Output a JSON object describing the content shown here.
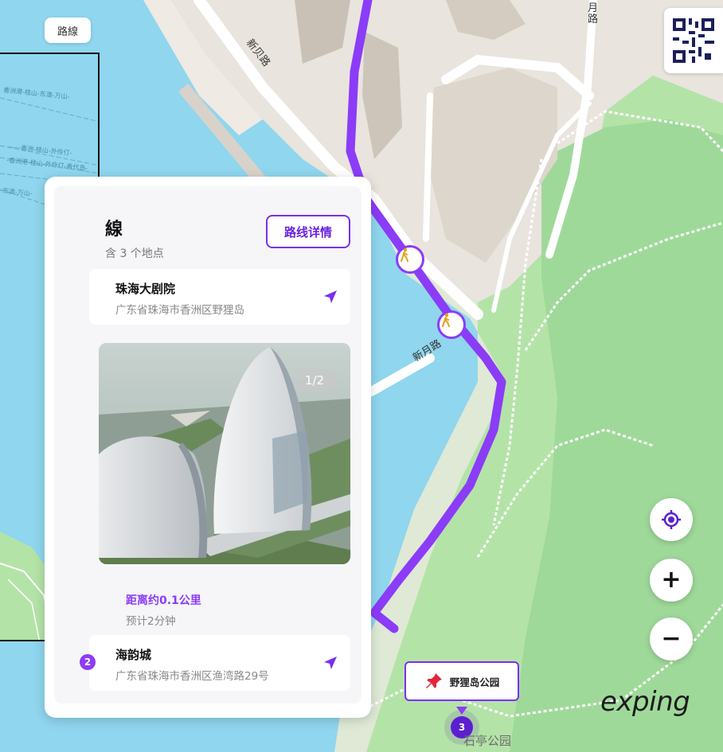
{
  "map": {
    "route_tag": "路線",
    "street_labels": {
      "xinbei": "新贝路",
      "xinyue": "新月路",
      "yue_top": "月路"
    },
    "bottom_label": "石亭公园",
    "logo": "exping",
    "colors": {
      "water": "#8fd6ee",
      "land": "#e9e4dd",
      "park": "#b4e3a8",
      "park_dark": "#9fd99a",
      "route": "#8b3cf7",
      "accent": "#6a22e0"
    },
    "controls": {
      "locate_icon": "target-icon",
      "zoom_in": "+",
      "zoom_out": "−"
    }
  },
  "inset": {
    "ferry_labels": [
      "香洲港-桂山-东澳-万山-",
      "——香洲-桂山-外伶仃-",
      "-香洲港-桂山-外伶仃-香代岛-",
      "-东澳-万山-"
    ]
  },
  "card": {
    "title": "線",
    "subtitle": "含 3 个地点",
    "detail_button": "路线详情",
    "stops": [
      {
        "number": "",
        "name": "珠海大剧院",
        "address": "广东省珠海市香洲区野狸岛"
      },
      {
        "number": "2",
        "name": "海韵城",
        "address": "广东省珠海市香洲区渔湾路29号"
      }
    ],
    "photo_counter": "1/2",
    "distance": "距离约0.1公里",
    "duration": "预计2分钟"
  },
  "poi": {
    "label": "野狸岛公园",
    "icon": "pushpin-icon",
    "marker_number": "3"
  }
}
